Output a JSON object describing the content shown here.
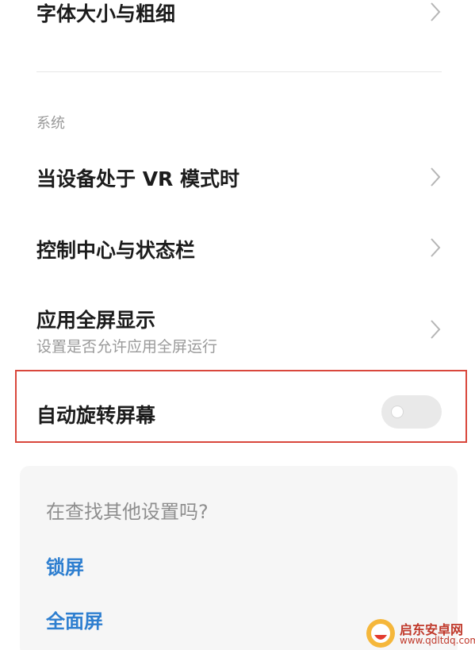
{
  "settings": {
    "font_size": {
      "title": "字体大小与粗细"
    },
    "section_label": "系统",
    "vr_mode": {
      "title": "当设备处于 VR 模式时"
    },
    "control_center": {
      "title": "控制中心与状态栏"
    },
    "fullscreen_apps": {
      "title": "应用全屏显示",
      "subtitle": "设置是否允许应用全屏运行"
    },
    "auto_rotate": {
      "title": "自动旋转屏幕",
      "enabled": false
    }
  },
  "suggestions": {
    "title": "在查找其他设置吗?",
    "links": [
      "锁屏",
      "全面屏"
    ]
  },
  "watermark": {
    "name": "启东安卓网",
    "url": "www.qdltdq.com"
  },
  "colors": {
    "highlight_border": "#d9473c",
    "link": "#2e7fd0",
    "toggle_off": "#e9e9e9"
  },
  "icons": {
    "chevron": "chevron-right-icon",
    "watermark_logo": "watermark-logo-icon"
  }
}
